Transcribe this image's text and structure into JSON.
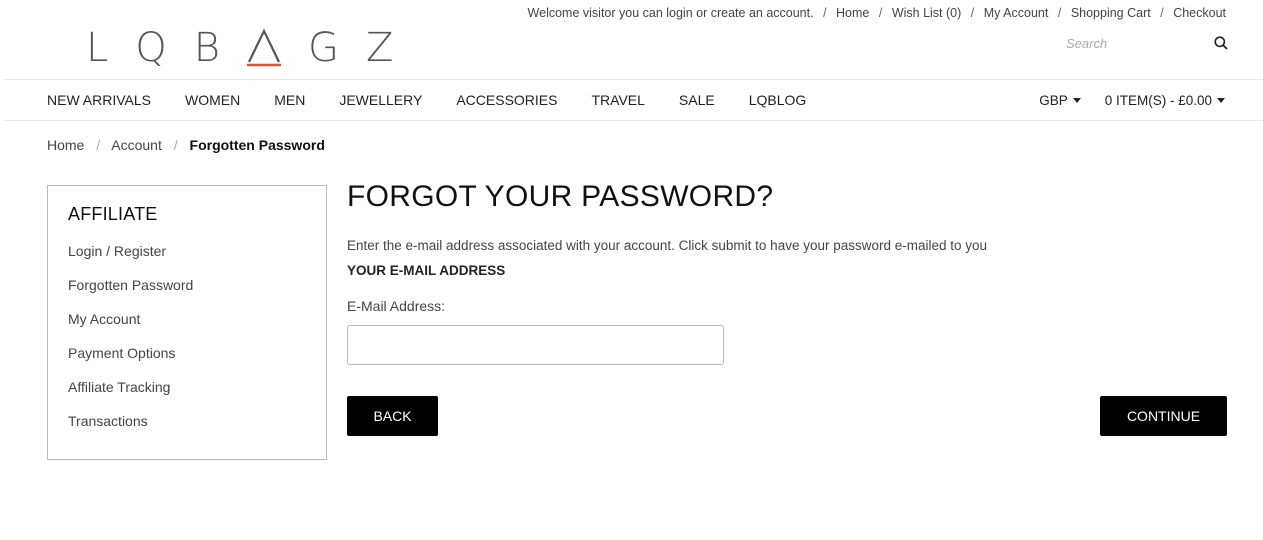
{
  "brand": {
    "logo_letters": [
      "L",
      "Q",
      "B",
      "A",
      "G",
      "Z"
    ],
    "accent_color": "#e0522e"
  },
  "top_links": {
    "welcome": "Welcome visitor you can login or create an account.",
    "items": [
      "Home",
      "Wish List (0)",
      "My Account",
      "Shopping Cart",
      "Checkout"
    ],
    "separator": "/"
  },
  "search": {
    "placeholder": "Search",
    "icon": "search-icon"
  },
  "nav": {
    "items": [
      "NEW ARRIVALS",
      "WOMEN",
      "MEN",
      "JEWELLERY",
      "ACCESSORIES",
      "TRAVEL",
      "SALE",
      "LQBLOG"
    ],
    "currency": "GBP",
    "cart": "0 ITEM(S) - £0.00"
  },
  "breadcrumb": {
    "items": [
      "Home",
      "Account"
    ],
    "current": "Forgotten Password",
    "separator": "/"
  },
  "sidebar": {
    "title": "AFFILIATE",
    "items": [
      "Login / Register",
      "Forgotten Password",
      "My Account",
      "Payment Options",
      "Affiliate Tracking",
      "Transactions"
    ]
  },
  "main": {
    "title": "FORGOT YOUR PASSWORD?",
    "intro": "Enter the e-mail address associated with your account. Click submit to have your password e-mailed to you",
    "section_title": "YOUR E-MAIL ADDRESS",
    "email_label": "E-Mail Address:",
    "email_value": "",
    "back_label": "BACK",
    "continue_label": "CONTINUE"
  }
}
